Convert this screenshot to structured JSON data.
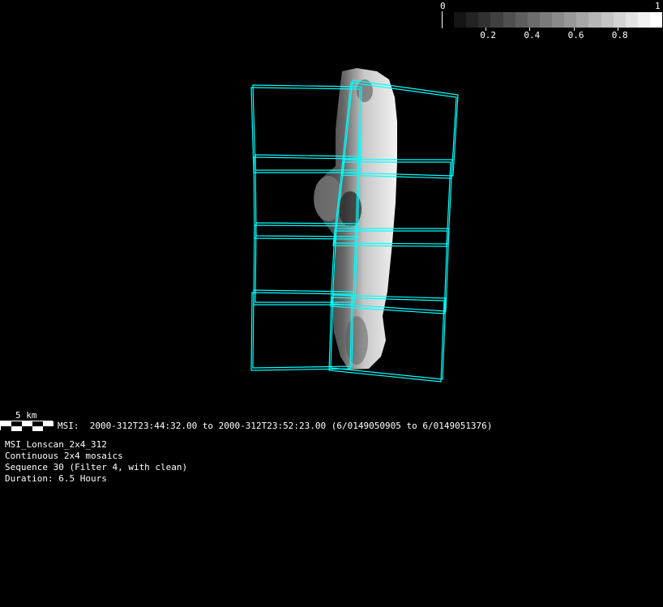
{
  "colorbar": {
    "min_label": "0",
    "max_label": "1",
    "tick_labels": [
      "0.2",
      "0.4",
      "0.6",
      "0.8"
    ],
    "steps": 17
  },
  "scale_bar": {
    "label": "5 km"
  },
  "observation": {
    "time_range": "MSI:  2000-312T23:44:32.00 to 2000-312T23:52:23.00 (6/0149050905 to 6/0149051376)"
  },
  "info": {
    "lines": [
      "MSI_Lonscan_2x4_312",
      "Continuous 2x4 mosaics",
      "Sequence 30 (Filter 4, with clean)",
      "Duration: 6.5 Hours"
    ]
  },
  "colors": {
    "footprint": "#00ffff",
    "background": "#000000"
  }
}
